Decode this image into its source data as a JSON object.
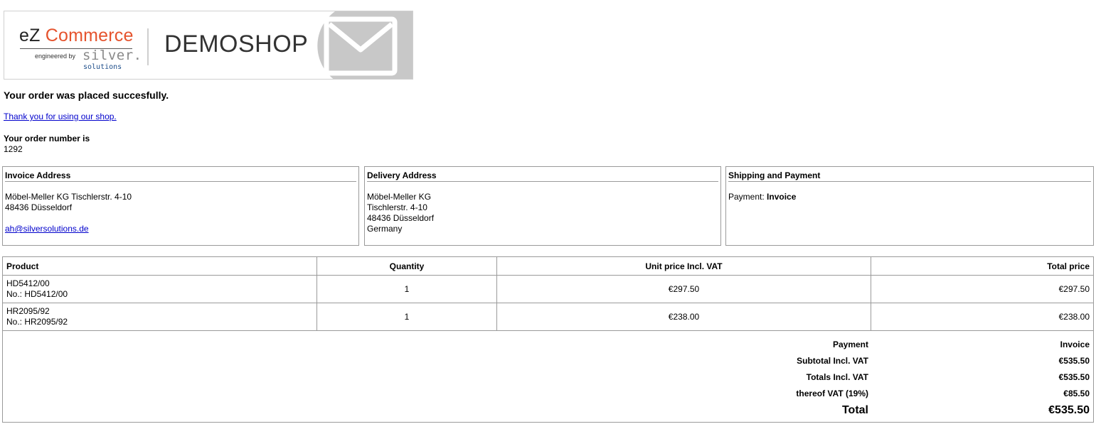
{
  "banner": {
    "logo_ez": "eZ",
    "logo_commerce": "Commerce",
    "logo_engineered_by": "engineered by",
    "logo_silver": "silver.",
    "logo_solutions": "solutions",
    "shop_name": "DEMOSHOP",
    "envelope_icon": "envelope-icon",
    "colors": {
      "commerce": "#e5532d",
      "envelope_bg": "#c8c8c8",
      "solutions": "#1d4d8a"
    }
  },
  "confirmation": {
    "headline": "Your order was placed succesfully.",
    "thanks_link": "Thank you for using our shop.",
    "order_number_label": "Your order number is",
    "order_number": "1292"
  },
  "invoice_address": {
    "title": "Invoice Address",
    "line1": "Möbel-Meller KG Tischlerstr. 4-10",
    "line2": "48436 Düsseldorf",
    "email": "ah@silversolutions.de"
  },
  "delivery_address": {
    "title": "Delivery Address",
    "line1": "Möbel-Meller KG",
    "line2": "Tischlerstr. 4-10",
    "line3": "48436 Düsseldorf",
    "line4": "Germany"
  },
  "shipping_payment": {
    "title": "Shipping and Payment",
    "payment_label": "Payment:",
    "payment_value": "Invoice"
  },
  "products_table": {
    "headers": {
      "product": "Product",
      "quantity": "Quantity",
      "unit_price": "Unit price Incl. VAT",
      "total_price": "Total price"
    },
    "rows": [
      {
        "name": "HD5412/00",
        "number": "No.: HD5412/00",
        "quantity": "1",
        "unit_price": "€297.50",
        "total_price": "€297.50"
      },
      {
        "name": "HR2095/92",
        "number": "No.: HR2095/92",
        "quantity": "1",
        "unit_price": "€238.00",
        "total_price": "€238.00"
      }
    ]
  },
  "totals": {
    "payment_label": "Payment",
    "payment_value": "Invoice",
    "subtotal_label": "Subtotal Incl. VAT",
    "subtotal_value": "€535.50",
    "totals_label": "Totals Incl. VAT",
    "totals_value": "€535.50",
    "vat_label": "thereof VAT (19%)",
    "vat_value": "€85.50",
    "grand_label": "Total",
    "grand_value": "€535.50"
  }
}
